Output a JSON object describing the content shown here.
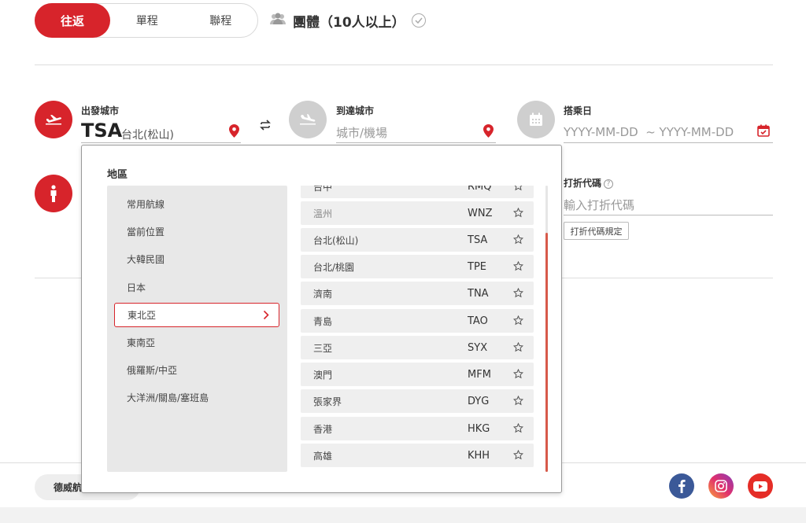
{
  "trip_type": {
    "tabs": [
      {
        "label": "往返",
        "active": true
      },
      {
        "label": "單程",
        "active": false
      },
      {
        "label": "聯程",
        "active": false
      }
    ],
    "group_label": "團體（10人以上）"
  },
  "departure": {
    "label": "出發城市",
    "code": "TSA",
    "name": "台北(松山)"
  },
  "arrival": {
    "label": "到達城市",
    "placeholder": "城市/機場"
  },
  "date": {
    "label": "搭乘日",
    "placeholder": "YYYY-MM-DD  ~ YYYY-MM-DD"
  },
  "promo": {
    "label": "打折代碼",
    "help": "?",
    "placeholder": "輸入打折代碼",
    "rules_button": "打折代碼規定"
  },
  "dropdown": {
    "title": "地區",
    "regions": [
      {
        "label": "常用航線",
        "active": false
      },
      {
        "label": "當前位置",
        "active": false
      },
      {
        "label": "大韓民國",
        "active": false
      },
      {
        "label": "日本",
        "active": false
      },
      {
        "label": "東北亞",
        "active": true
      },
      {
        "label": "東南亞",
        "active": false
      },
      {
        "label": "俄羅斯/中亞",
        "active": false
      },
      {
        "label": "大洋洲/關島/塞班島",
        "active": false
      }
    ],
    "cities": [
      {
        "name": "台中",
        "code": "RMQ"
      },
      {
        "name": "溫州",
        "code": "WNZ"
      },
      {
        "name": "台北(松山)",
        "code": "TSA"
      },
      {
        "name": "台北/桃園",
        "code": "TPE"
      },
      {
        "name": "濟南",
        "code": "TNA"
      },
      {
        "name": "青島",
        "code": "TAO"
      },
      {
        "name": "三亞",
        "code": "SYX"
      },
      {
        "name": "澳門",
        "code": "MFM"
      },
      {
        "name": "張家界",
        "code": "DYG"
      },
      {
        "name": "香港",
        "code": "HKG"
      },
      {
        "name": "高雄",
        "code": "KHH"
      }
    ]
  },
  "footer": {
    "pill_label": "德威航空"
  },
  "colors": {
    "accent": "#d7242b",
    "scrollbar": "#d75a4a"
  },
  "icons": [
    "plane-takeoff-icon",
    "plane-landing-icon",
    "calendar-icon",
    "person-icon",
    "location-pin-icon",
    "swap-icon",
    "chevron-right-icon",
    "star-icon",
    "facebook-icon",
    "instagram-icon",
    "youtube-icon"
  ]
}
